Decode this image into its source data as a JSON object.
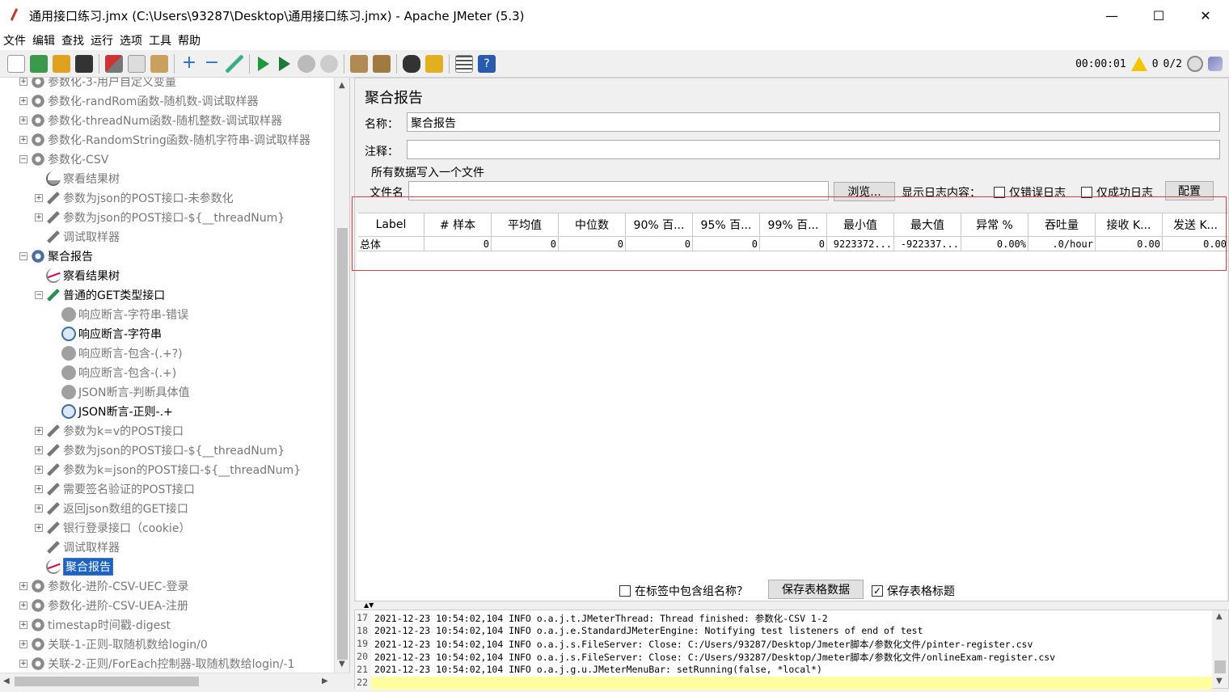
{
  "window": {
    "title": "通用接口练习.jmx (C:\\Users\\93287\\Desktop\\通用接口练习.jmx) - Apache JMeter (5.3)",
    "minimize": "—",
    "maximize": "☐",
    "close": "✕"
  },
  "menu": [
    "文件",
    "编辑",
    "查找",
    "运行",
    "选项",
    "工具",
    "帮助"
  ],
  "status": {
    "elapsed": "00:00:01",
    "warnings": "0",
    "threads": "0/2"
  },
  "tree": [
    {
      "label": "参数化-3-用户自定义变量",
      "icon": "gear-icon",
      "level": 0,
      "exp": "+",
      "dim": true
    },
    {
      "label": "参数化-randRom函数-随机数-调试取样器",
      "icon": "gear-icon",
      "level": 0,
      "exp": "+",
      "dim": true
    },
    {
      "label": "参数化-threadNum函数-随机整数-调试取样器",
      "icon": "gear-icon",
      "level": 0,
      "exp": "+",
      "dim": true
    },
    {
      "label": "参数化-RandomString函数-随机字符串-调试取样器",
      "icon": "gear-icon",
      "level": 0,
      "exp": "+",
      "dim": true
    },
    {
      "label": "参数化-CSV",
      "icon": "gear-icon",
      "level": 0,
      "exp": "−",
      "dim": true
    },
    {
      "label": "察看结果树",
      "icon": "chart-icon",
      "level": 1,
      "exp": "",
      "dim": true
    },
    {
      "label": "参数为json的POST接口-未参数化",
      "icon": "pen-icon",
      "level": 1,
      "exp": "+",
      "dim": true
    },
    {
      "label": "参数为json的POST接口-${__threadNum}",
      "icon": "pen-icon",
      "level": 1,
      "exp": "+",
      "dim": true
    },
    {
      "label": "调试取样器",
      "icon": "pen-icon",
      "level": 1,
      "exp": "",
      "dim": true
    },
    {
      "label": "聚合报告",
      "icon": "gear-blue-icon",
      "level": 0,
      "exp": "−",
      "dim": false
    },
    {
      "label": "察看结果树",
      "icon": "chart-pink-icon",
      "level": 1,
      "exp": "",
      "dim": false
    },
    {
      "label": "普通的GET类型接口",
      "icon": "pen-green-icon",
      "level": 1,
      "exp": "−",
      "dim": false
    },
    {
      "label": "响应断言-字符串-错误",
      "icon": "shield-icon",
      "level": 2,
      "exp": "",
      "dim": true
    },
    {
      "label": "响应断言-字符串",
      "icon": "search-icon",
      "level": 2,
      "exp": "",
      "dim": false
    },
    {
      "label": "响应断言-包含-(.+?)",
      "icon": "shield-icon",
      "level": 2,
      "exp": "",
      "dim": true
    },
    {
      "label": "响应断言-包含-(.+)",
      "icon": "shield-icon",
      "level": 2,
      "exp": "",
      "dim": true
    },
    {
      "label": "JSON断言-判断具体值",
      "icon": "shield-icon",
      "level": 2,
      "exp": "",
      "dim": true
    },
    {
      "label": "JSON断言-正则-.+",
      "icon": "search-icon",
      "level": 2,
      "exp": "",
      "dim": false
    },
    {
      "label": "参数为k=v的POST接口",
      "icon": "pen-icon",
      "level": 1,
      "exp": "+",
      "dim": true
    },
    {
      "label": "参数为json的POST接口-${__threadNum}",
      "icon": "pen-icon",
      "level": 1,
      "exp": "+",
      "dim": true
    },
    {
      "label": "参数为k=json的POST接口-${__threadNum}",
      "icon": "pen-icon",
      "level": 1,
      "exp": "+",
      "dim": true
    },
    {
      "label": "需要签名验证的POST接口",
      "icon": "pen-icon",
      "level": 1,
      "exp": "+",
      "dim": true
    },
    {
      "label": "返回json数组的GET接口",
      "icon": "pen-icon",
      "level": 1,
      "exp": "+",
      "dim": true
    },
    {
      "label": "银行登录接口（cookie）",
      "icon": "pen-icon",
      "level": 1,
      "exp": "+",
      "dim": true
    },
    {
      "label": "调试取样器",
      "icon": "pen-icon",
      "level": 1,
      "exp": "",
      "dim": true
    },
    {
      "label": "聚合报告",
      "icon": "chart-pink-icon",
      "level": 1,
      "exp": "",
      "dim": false,
      "selected": true
    },
    {
      "label": "参数化-进阶-CSV-UEC-登录",
      "icon": "gear-icon",
      "level": 0,
      "exp": "+",
      "dim": true
    },
    {
      "label": "参数化-进阶-CSV-UEA-注册",
      "icon": "gear-icon",
      "level": 0,
      "exp": "+",
      "dim": true
    },
    {
      "label": "timestap时间戳-digest",
      "icon": "gear-icon",
      "level": 0,
      "exp": "+",
      "dim": true
    },
    {
      "label": "关联-1-正则-取随机数给login/0",
      "icon": "gear-icon",
      "level": 0,
      "exp": "+",
      "dim": true
    },
    {
      "label": "关联-2-正则/ForEach控制器-取随机数给login/-1",
      "icon": "gear-icon",
      "level": 0,
      "exp": "+",
      "dim": true
    }
  ],
  "panel": {
    "title": "聚合报告",
    "name_label": "名称：",
    "name_value": "聚合报告",
    "comment_label": "注释：",
    "comment_value": "",
    "fieldset_label": "所有数据写入一个文件",
    "filename_label": "文件名",
    "filename_value": "",
    "browse_button": "浏览...",
    "log_content_label": "显示日志内容：",
    "errors_only": "仅错误日志",
    "success_only": "仅成功日志",
    "configure_button": "配置"
  },
  "table": {
    "headers": [
      "Label",
      "# 样本",
      "平均值",
      "中位数",
      "90% 百...",
      "95% 百...",
      "99% 百...",
      "最小值",
      "最大值",
      "异常 %",
      "吞吐量",
      "接收 K...",
      "发送 K..."
    ],
    "rows": [
      [
        "总体",
        "0",
        "0",
        "0",
        "0",
        "0",
        "0",
        "9223372...",
        "-922337...",
        "0.00%",
        ".0/hour",
        "0.00",
        "0.00"
      ]
    ]
  },
  "bottom": {
    "include_group": "在标签中包含组名称？",
    "save_table": "保存表格数据",
    "save_header": "保存表格标题",
    "save_header_checked": "✓"
  },
  "log": [
    {
      "n": "17",
      "text": "2021-12-23 10:54:02,104 INFO o.a.j.t.JMeterThread: Thread finished: 参数化-CSV 1-2"
    },
    {
      "n": "18",
      "text": "2021-12-23 10:54:02,104 INFO o.a.j.e.StandardJMeterEngine: Notifying test listeners of end of test"
    },
    {
      "n": "19",
      "text": "2021-12-23 10:54:02,104 INFO o.a.j.s.FileServer: Close: C:/Users/93287/Desktop/Jmeter脚本/参数化文件/pinter-register.csv"
    },
    {
      "n": "20",
      "text": "2021-12-23 10:54:02,104 INFO o.a.j.s.FileServer: Close: C:/Users/93287/Desktop/Jmeter脚本/参数化文件/onlineExam-register.csv"
    },
    {
      "n": "21",
      "text": "2021-12-23 10:54:02,104 INFO o.a.j.g.u.JMeterMenuBar: setRunning(false, *local*)"
    },
    {
      "n": "22",
      "text": ""
    }
  ]
}
